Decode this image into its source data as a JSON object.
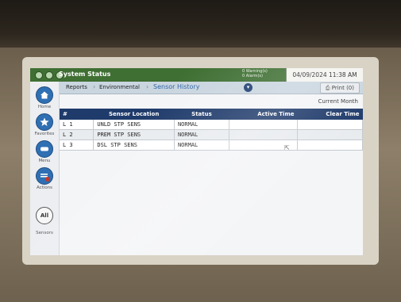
{
  "header": {
    "title": "System Status",
    "warnings": "0 Warning(s)",
    "alarms": "0 Alarm(s)",
    "datetime": "04/09/2024 11:38 AM"
  },
  "breadcrumb": {
    "items": [
      "Reports",
      "Environmental",
      "Sensor History"
    ]
  },
  "toolbar": {
    "print_label": "Print (0)",
    "period": "Current Month"
  },
  "nav": {
    "home": "Home",
    "favorites": "Favorites",
    "menu": "Menu",
    "actions": "Actions",
    "all": "All",
    "sensors": "Sensors"
  },
  "table": {
    "headers": [
      "#",
      "Sensor Location",
      "Status",
      "Active Time",
      "Clear Time"
    ],
    "rows": [
      [
        "L 1",
        "UNLD STP SENS",
        "NORMAL",
        "",
        ""
      ],
      [
        "L 2",
        "PREM STP SENS",
        "NORMAL",
        "",
        ""
      ],
      [
        "L 3",
        "DSL STP SENS",
        "NORMAL",
        "",
        ""
      ]
    ]
  },
  "colors": {
    "titlebar": "#3f6f33",
    "table_header": "#1f3b6b",
    "nav_icon": "#2f6fb3",
    "active_crumb": "#2f66a8"
  },
  "icons": [
    "home-icon",
    "star-icon",
    "menu-icon",
    "actions-icon",
    "print-icon",
    "dropdown-icon"
  ]
}
